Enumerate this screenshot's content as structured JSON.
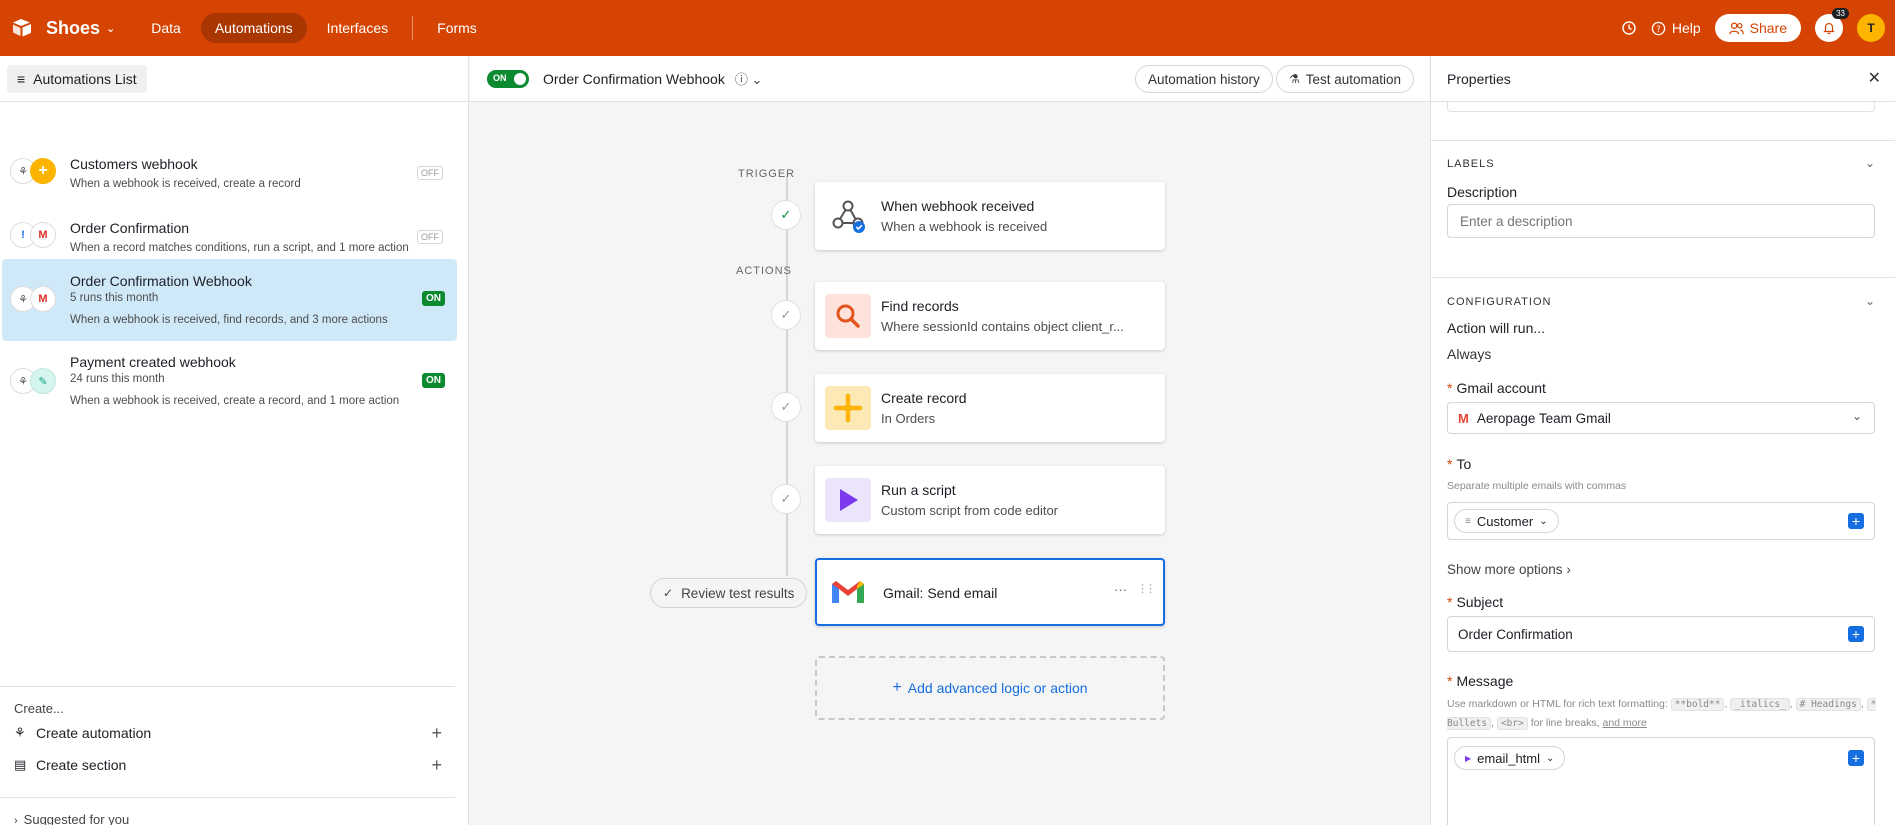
{
  "app": {
    "base_name": "Shoes",
    "nav": [
      "Data",
      "Automations",
      "Interfaces",
      "Forms"
    ],
    "active_nav": "Automations",
    "help_label": "Help",
    "share_label": "Share",
    "notification_count": "33",
    "user_initial": "T",
    "brand_color": "#d54402"
  },
  "sidebar": {
    "list_button_label": "Automations List",
    "automations": [
      {
        "title": "Customers webhook",
        "runs": "",
        "description": "When a webhook is received, create a record",
        "status": "OFF"
      },
      {
        "title": "Order Confirmation",
        "runs": "",
        "description": "When a record matches conditions, run a script, and 1 more action",
        "status": "OFF"
      },
      {
        "title": "Order Confirmation Webhook",
        "runs": "5 runs this month",
        "description": "When a webhook is received, find records, and 3 more actions",
        "status": "ON"
      },
      {
        "title": "Payment created webhook",
        "runs": "24 runs this month",
        "description": "When a webhook is received, create a record, and 1 more action",
        "status": "ON"
      }
    ],
    "create_label": "Create...",
    "create_automation": "Create automation",
    "create_section": "Create section",
    "suggested": "Suggested for you"
  },
  "canvas": {
    "toggle_label": "ON",
    "automation_name": "Order Confirmation Webhook",
    "history_button": "Automation history",
    "test_button": "Test automation",
    "trigger_label": "TRIGGER",
    "actions_label": "ACTIONS",
    "steps": [
      {
        "title": "When webhook received",
        "subtitle": "When a webhook is received",
        "icon": "webhook-icon"
      },
      {
        "title": "Find records",
        "subtitle": "Where sessionId contains object client_r...",
        "icon": "search-icon"
      },
      {
        "title": "Create record",
        "subtitle": "In Orders",
        "icon": "plus-icon"
      },
      {
        "title": "Run a script",
        "subtitle": "Custom script from code editor",
        "icon": "play-icon"
      },
      {
        "title": "Gmail: Send email",
        "subtitle": "",
        "icon": "gmail-icon"
      }
    ],
    "more_glyph": "···",
    "drag_glyph": "⋮⋮",
    "review_button": "Review test results",
    "add_action": "Add advanced logic or action"
  },
  "properties": {
    "title": "Properties",
    "labels_section": "LABELS",
    "description_label": "Description",
    "description_placeholder": "Enter a description",
    "config_section": "CONFIGURATION",
    "action_will_run": "Action will run...",
    "run_condition": "Always",
    "gmail_account_label": "Gmail account",
    "gmail_account_value": "Aeropage Team Gmail",
    "to_label": "To",
    "to_hint": "Separate multiple emails with commas",
    "to_value": "Customer",
    "show_more": "Show more options",
    "subject_label": "Subject",
    "subject_value": "Order Confirmation",
    "message_label": "Message",
    "message_hint_1": "Use markdown or HTML for rich text formatting:",
    "md_bold": "**bold**",
    "md_italics": "_italics_",
    "md_headings": "# Headings",
    "md_bullets": "* Bullets",
    "md_br": "<br>",
    "message_hint_2": "for line breaks,",
    "and_more": "and more",
    "message_value": "email_html"
  }
}
